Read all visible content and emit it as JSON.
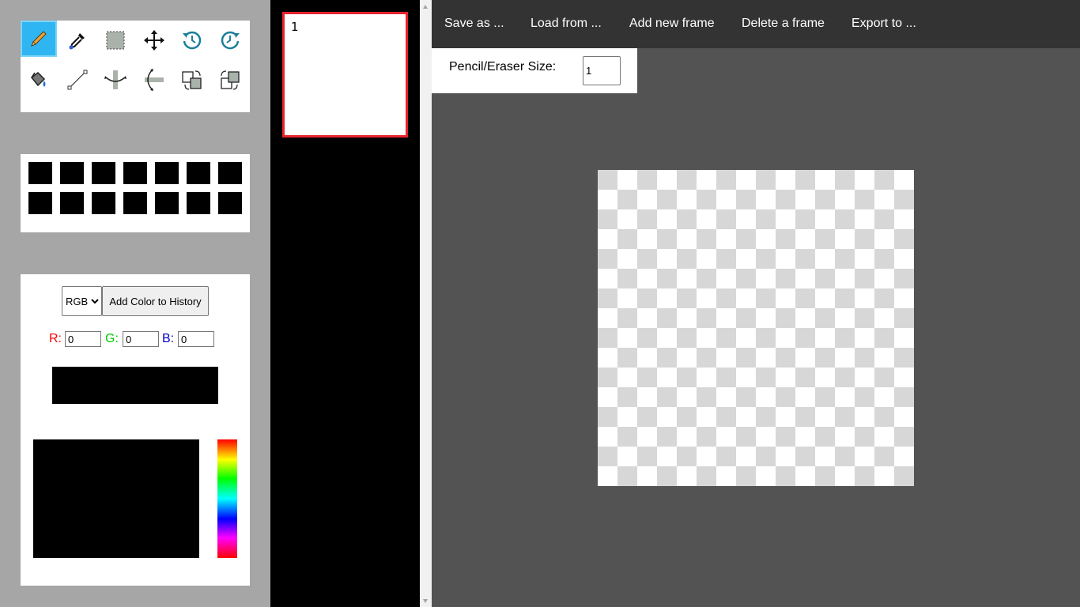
{
  "tools": [
    {
      "name": "pencil-tool",
      "icon": "pencil-icon",
      "active": true
    },
    {
      "name": "eyedropper-tool",
      "icon": "eyedropper-icon",
      "active": false
    },
    {
      "name": "select-tool",
      "icon": "marquee-select-icon",
      "active": false
    },
    {
      "name": "move-tool",
      "icon": "move-arrows-icon",
      "active": false
    },
    {
      "name": "rotate-left-tool",
      "icon": "rotate-counterclockwise-icon",
      "active": false
    },
    {
      "name": "rotate-right-tool",
      "icon": "rotate-clockwise-icon",
      "active": false
    },
    {
      "name": "fill-tool",
      "icon": "paint-bucket-icon",
      "active": false
    },
    {
      "name": "line-tool",
      "icon": "line-icon",
      "active": false
    },
    {
      "name": "flip-vertical-tool",
      "icon": "flip-vertical-icon",
      "active": false
    },
    {
      "name": "flip-horizontal-tool",
      "icon": "flip-horizontal-icon",
      "active": false
    },
    {
      "name": "swap-tool",
      "icon": "swap-layers-icon",
      "active": false
    },
    {
      "name": "swap-alt-tool",
      "icon": "swap-layers-alt-icon",
      "active": false
    }
  ],
  "color_history": [
    "#000000",
    "#000000",
    "#000000",
    "#000000",
    "#000000",
    "#000000",
    "#000000",
    "#000000",
    "#000000",
    "#000000",
    "#000000",
    "#000000",
    "#000000",
    "#000000"
  ],
  "color_picker": {
    "mode_selected": "RGB",
    "add_history_label": "Add Color to History",
    "r_label": "R:",
    "g_label": "G:",
    "b_label": "B:",
    "r_value": "0",
    "g_value": "0",
    "b_value": "0",
    "current_color": "#000000",
    "r_color": "#ff0000",
    "g_color": "#00cc00",
    "b_color": "#0000cc"
  },
  "frames": [
    {
      "number": "1",
      "selected": true
    }
  ],
  "menu": {
    "save": "Save as ...",
    "load": "Load from ...",
    "add_frame": "Add new frame",
    "delete_frame": "Delete a frame",
    "export": "Export to ..."
  },
  "pencil_size": {
    "label": "Pencil/Eraser Size:",
    "value": "1"
  },
  "colors": {
    "active_tool": "#2fb6f2",
    "selected_frame_border": "#e8232d",
    "menu_bg": "#333333",
    "workspace_bg": "#535353",
    "sidebar_bg": "#a6a6a6"
  }
}
